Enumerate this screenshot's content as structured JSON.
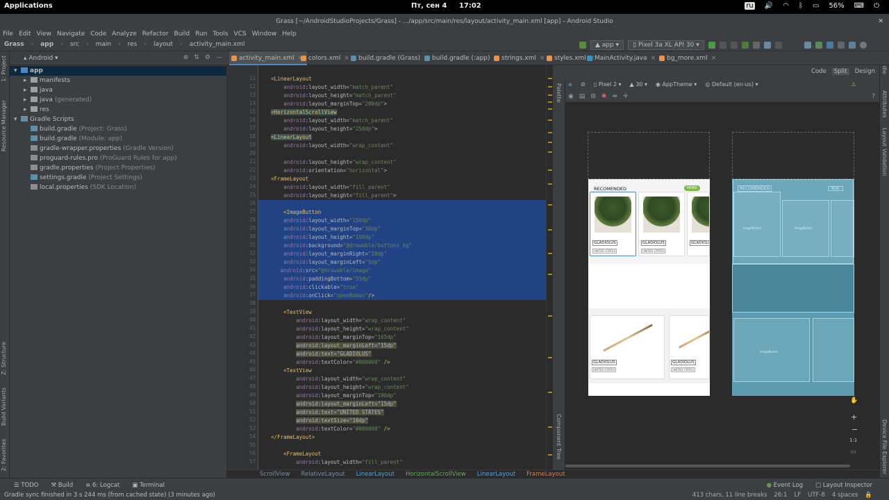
{
  "system": {
    "apps": "Applications",
    "datetime": "Пт, сен 4",
    "time": "17:02",
    "keyboard": "ru",
    "battery": "56%"
  },
  "window": {
    "title": "Grass [~/AndroidStudioProjects/Grass] - .../app/src/main/res/layout/activity_main.xml [app] - Android Studio"
  },
  "menu": [
    "File",
    "Edit",
    "View",
    "Navigate",
    "Code",
    "Analyze",
    "Refactor",
    "Build",
    "Run",
    "Tools",
    "VCS",
    "Window",
    "Help"
  ],
  "breadcrumbs": [
    "Grass",
    "app",
    "src",
    "main",
    "res",
    "layout",
    "activity_main.xml"
  ],
  "run": {
    "config": "app",
    "device": "Pixel 3a XL API 30"
  },
  "project": {
    "view": "Android",
    "tree": [
      {
        "label": "app",
        "extra": "",
        "depth": 0,
        "arrow": "▾",
        "selected": true,
        "color": "#4a88c7"
      },
      {
        "label": "manifests",
        "extra": "",
        "depth": 1,
        "arrow": "▸",
        "color": "#a0a0a0"
      },
      {
        "label": "java",
        "extra": "",
        "depth": 1,
        "arrow": "▸",
        "color": "#a0a0a0"
      },
      {
        "label": "java",
        "extra": " (generated)",
        "depth": 1,
        "arrow": "▸",
        "color": "#a0a0a0"
      },
      {
        "label": "res",
        "extra": "",
        "depth": 1,
        "arrow": "▸",
        "color": "#a0a0a0"
      },
      {
        "label": "Gradle Scripts",
        "extra": "",
        "depth": 0,
        "arrow": "▾",
        "color": "#6a8fa5"
      },
      {
        "label": "build.gradle",
        "extra": " (Project: Grass)",
        "depth": 1,
        "arrow": "",
        "color": "#5b8fa8"
      },
      {
        "label": "build.gradle",
        "extra": " (Module: app)",
        "depth": 1,
        "arrow": "",
        "color": "#5b8fa8"
      },
      {
        "label": "gradle-wrapper.properties",
        "extra": " (Gradle Version)",
        "depth": 1,
        "arrow": "",
        "color": "#8c8c8c"
      },
      {
        "label": "proguard-rules.pro",
        "extra": " (ProGuard Rules for app)",
        "depth": 1,
        "arrow": "",
        "color": "#8c8c8c"
      },
      {
        "label": "gradle.properties",
        "extra": " (Project Properties)",
        "depth": 1,
        "arrow": "",
        "color": "#8c8c8c"
      },
      {
        "label": "settings.gradle",
        "extra": " (Project Settings)",
        "depth": 1,
        "arrow": "",
        "color": "#5b8fa8"
      },
      {
        "label": "local.properties",
        "extra": " (SDK Location)",
        "depth": 1,
        "arrow": "",
        "color": "#8c8c8c"
      }
    ]
  },
  "left_tool_tabs": [
    "1: Project",
    "Resource Manager",
    "Z: Structure",
    "Build Variants",
    "2: Favorites"
  ],
  "right_tool_tabs": [
    "Gradle",
    "Attributes",
    "Layout Validation",
    "Device File Explorer"
  ],
  "tabs": [
    {
      "label": "activity_main.xml",
      "color": "#e8924a"
    },
    {
      "label": "colors.xml",
      "color": "#e8924a"
    },
    {
      "label": "build.gradle (Grass)",
      "color": "#5b8fa8"
    },
    {
      "label": "build.gradle (:app)",
      "color": "#5b8fa8"
    },
    {
      "label": "strings.xml",
      "color": "#e8924a"
    },
    {
      "label": "styles.xml",
      "color": "#e8924a"
    },
    {
      "label": "MainActivity.java",
      "color": "#3592c4"
    },
    {
      "label": "bg_more.xml",
      "color": "#e8924a"
    }
  ],
  "line_numbers": [
    "11",
    "12",
    "13",
    "14",
    "15",
    "16",
    "17",
    "18",
    "19",
    "20",
    "21",
    "22",
    "23",
    "24",
    "25",
    "26",
    "27",
    "28",
    "29",
    "30",
    "31",
    "32",
    "33",
    "34",
    "35",
    "36",
    "37",
    "38",
    "39",
    "40",
    "41",
    "42",
    "43",
    "44",
    "45",
    "46",
    "47",
    "48",
    "49",
    "50",
    "51",
    "52",
    "53",
    "54",
    "55",
    "56",
    "57"
  ],
  "code": [
    [
      [
        "",
        "    "
      ],
      [
        "tg",
        "<LinearLayout"
      ]
    ],
    [
      [
        "",
        "        "
      ],
      [
        "ns",
        "android"
      ],
      [
        "at",
        ":layout_width="
      ],
      [
        "st",
        "\"match_parent\""
      ]
    ],
    [
      [
        "",
        "        "
      ],
      [
        "ns",
        "android"
      ],
      [
        "at",
        ":layout_height="
      ],
      [
        "st",
        "\"match_parent\""
      ]
    ],
    [
      [
        "",
        "        "
      ],
      [
        "ns",
        "android"
      ],
      [
        "at",
        ":layout_marginTop="
      ],
      [
        "st",
        "\"200dp\""
      ],
      [
        "at",
        ">"
      ]
    ],
    [
      [
        "",
        "    "
      ],
      [
        "tgh",
        "<HorizontalScrollView"
      ]
    ],
    [
      [
        "",
        "        "
      ],
      [
        "ns",
        "android"
      ],
      [
        "at",
        ":layout_width="
      ],
      [
        "st",
        "\"match_parent\""
      ]
    ],
    [
      [
        "",
        "        "
      ],
      [
        "ns",
        "android"
      ],
      [
        "at",
        ":layout_height="
      ],
      [
        "st",
        "\"250dp\""
      ],
      [
        "at",
        ">"
      ]
    ],
    [
      [
        "",
        "    "
      ],
      [
        "tgh",
        "<LinearLayout"
      ]
    ],
    [
      [
        "",
        "        "
      ],
      [
        "ns",
        "android"
      ],
      [
        "at",
        ":layout_width="
      ],
      [
        "st",
        "\"wrap_content\""
      ]
    ],
    [
      [
        "",
        ""
      ]
    ],
    [
      [
        "",
        "        "
      ],
      [
        "ns",
        "android"
      ],
      [
        "at",
        ":layout_height="
      ],
      [
        "st",
        "\"wrap_content\""
      ]
    ],
    [
      [
        "",
        "        "
      ],
      [
        "ns",
        "android"
      ],
      [
        "at",
        ":orientation="
      ],
      [
        "st",
        "\"horizontal\""
      ],
      [
        "at",
        ">"
      ]
    ],
    [
      [
        "",
        "    "
      ],
      [
        "tg",
        "<FrameLayout"
      ]
    ],
    [
      [
        "",
        "        "
      ],
      [
        "ns",
        "android"
      ],
      [
        "at",
        ":layout_width="
      ],
      [
        "st",
        "\"fill_parent\""
      ]
    ],
    [
      [
        "",
        "        "
      ],
      [
        "ns",
        "android"
      ],
      [
        "at",
        ":layout_height="
      ],
      [
        "st",
        "\"fill_parent\""
      ],
      [
        "at",
        ">"
      ]
    ],
    [
      [
        "",
        ""
      ]
    ],
    [
      [
        "",
        "        "
      ],
      [
        "tg",
        "<ImageButton"
      ]
    ],
    [
      [
        "",
        "        "
      ],
      [
        "ns",
        "android"
      ],
      [
        "at",
        ":layout_width="
      ],
      [
        "st",
        "\"150dp\""
      ]
    ],
    [
      [
        "",
        "        "
      ],
      [
        "ns",
        "android"
      ],
      [
        "at",
        ":layout_marginTop="
      ],
      [
        "st",
        "\"30dp\""
      ]
    ],
    [
      [
        "",
        "        "
      ],
      [
        "ns",
        "android"
      ],
      [
        "at",
        ":layout_height="
      ],
      [
        "st",
        "\"190dp\""
      ]
    ],
    [
      [
        "",
        "        "
      ],
      [
        "ns",
        "android"
      ],
      [
        "at",
        ":background="
      ],
      [
        "st",
        "\"@drawable/buttons_bg\""
      ]
    ],
    [
      [
        "",
        "        "
      ],
      [
        "ns",
        "android"
      ],
      [
        "at",
        ":layout_marginRight="
      ],
      [
        "st",
        "\"10dp\""
      ]
    ],
    [
      [
        "",
        "        "
      ],
      [
        "ns",
        "android"
      ],
      [
        "at",
        ":layout_marginLeft="
      ],
      [
        "st",
        "\"5dp\""
      ]
    ],
    [
      [
        "",
        "       "
      ],
      [
        "ns",
        "android"
      ],
      [
        "at",
        ":src="
      ],
      [
        "st",
        "\"@drawable/image\""
      ]
    ],
    [
      [
        "",
        "        "
      ],
      [
        "ns",
        "android"
      ],
      [
        "at",
        ":paddingBottom="
      ],
      [
        "st",
        "\"55dp\""
      ]
    ],
    [
      [
        "",
        "        "
      ],
      [
        "ns",
        "android"
      ],
      [
        "at",
        ":clickable="
      ],
      [
        "st",
        "\"true\""
      ]
    ],
    [
      [
        "",
        "        "
      ],
      [
        "ns",
        "android"
      ],
      [
        "at",
        ":onClick="
      ],
      [
        "st",
        "\"openRoman\""
      ],
      [
        "tg",
        "/>"
      ]
    ],
    [
      [
        "",
        ""
      ]
    ],
    [
      [
        "",
        "        "
      ],
      [
        "tg",
        "<TextView"
      ]
    ],
    [
      [
        "",
        "            "
      ],
      [
        "ns",
        "android"
      ],
      [
        "at",
        ":layout_width="
      ],
      [
        "st",
        "\"wrap_content\""
      ]
    ],
    [
      [
        "",
        "            "
      ],
      [
        "ns",
        "android"
      ],
      [
        "at",
        ":layout_height="
      ],
      [
        "st",
        "\"wrap_content\""
      ]
    ],
    [
      [
        "",
        "            "
      ],
      [
        "ns",
        "android"
      ],
      [
        "at",
        ":layout_marginTop="
      ],
      [
        "st",
        "\"165dp\""
      ]
    ],
    [
      [
        "",
        "            "
      ],
      [
        "hl",
        "android:layout_marginLeft=\"15dp\""
      ]
    ],
    [
      [
        "",
        "            "
      ],
      [
        "hl",
        "android:text=\"GLADIOLUS\""
      ]
    ],
    [
      [
        "",
        "            "
      ],
      [
        "ns",
        "android"
      ],
      [
        "at",
        ":textColor="
      ],
      [
        "st",
        "\"#000000\""
      ],
      [
        "tg",
        " />"
      ]
    ],
    [
      [
        "",
        "        "
      ],
      [
        "tg",
        "<TextView"
      ]
    ],
    [
      [
        "",
        "            "
      ],
      [
        "ns",
        "android"
      ],
      [
        "at",
        ":layout_width="
      ],
      [
        "st",
        "\"wrap_content\""
      ]
    ],
    [
      [
        "",
        "            "
      ],
      [
        "ns",
        "android"
      ],
      [
        "at",
        ":layout_height="
      ],
      [
        "st",
        "\"wrap_content\""
      ]
    ],
    [
      [
        "",
        "            "
      ],
      [
        "ns",
        "android"
      ],
      [
        "at",
        ":layout_marginTop="
      ],
      [
        "st",
        "\"190dp\""
      ]
    ],
    [
      [
        "",
        "            "
      ],
      [
        "hl",
        "android:layout_marginLeft=\"15dp\""
      ]
    ],
    [
      [
        "",
        "            "
      ],
      [
        "hl",
        "android:text=\"UNITED STATES\""
      ]
    ],
    [
      [
        "",
        "            "
      ],
      [
        "hl",
        "android:textSize=\"10dp\""
      ]
    ],
    [
      [
        "",
        "            "
      ],
      [
        "ns",
        "android"
      ],
      [
        "at",
        ":textColor="
      ],
      [
        "st",
        "\"#000000\""
      ],
      [
        "tg",
        " />"
      ]
    ],
    [
      [
        "",
        "    "
      ],
      [
        "tg",
        "</FrameLayout>"
      ]
    ],
    [
      [
        "",
        ""
      ]
    ],
    [
      [
        "",
        "        "
      ],
      [
        "tg",
        "<FrameLayout"
      ]
    ],
    [
      [
        "",
        "            "
      ],
      [
        "ns",
        "android"
      ],
      [
        "at",
        ":layout_width="
      ],
      [
        "st",
        "\"fill_parent\""
      ]
    ]
  ],
  "design": {
    "modes": [
      "Code",
      "Split",
      "Design"
    ],
    "active_mode": "Split",
    "device": "Pixel 2",
    "api": "30",
    "theme": "AppTheme",
    "locale": "Default (en-us)",
    "palette_label": "Palette",
    "component_tree_label": "Component Tree",
    "recommended": "RECOMENDED",
    "more": "MORE",
    "card_title": "GLADIOLUS",
    "card_sub": "UNITED STATES",
    "blueprint_label": "ImageButton",
    "zoom_ratio": "1:1"
  },
  "xml_breadcrumbs": [
    "ScrollView",
    "RelativeLayout",
    "LinearLayout",
    "HorizontalScrollView",
    "LinearLayout",
    "FrameLayout"
  ],
  "bottom_tools": {
    "left": [
      "TODO",
      "Build",
      "6: Logcat",
      "Terminal"
    ],
    "right": [
      "Event Log",
      "Layout Inspector"
    ]
  },
  "status": {
    "message": "Gradle sync finished in 3 s 244 ms (from cached state) (3 minutes ago)",
    "chars": "413 chars, 11 line breaks",
    "pos": "26:1",
    "lf": "LF",
    "enc": "UTF-8",
    "indent": "4 spaces"
  }
}
